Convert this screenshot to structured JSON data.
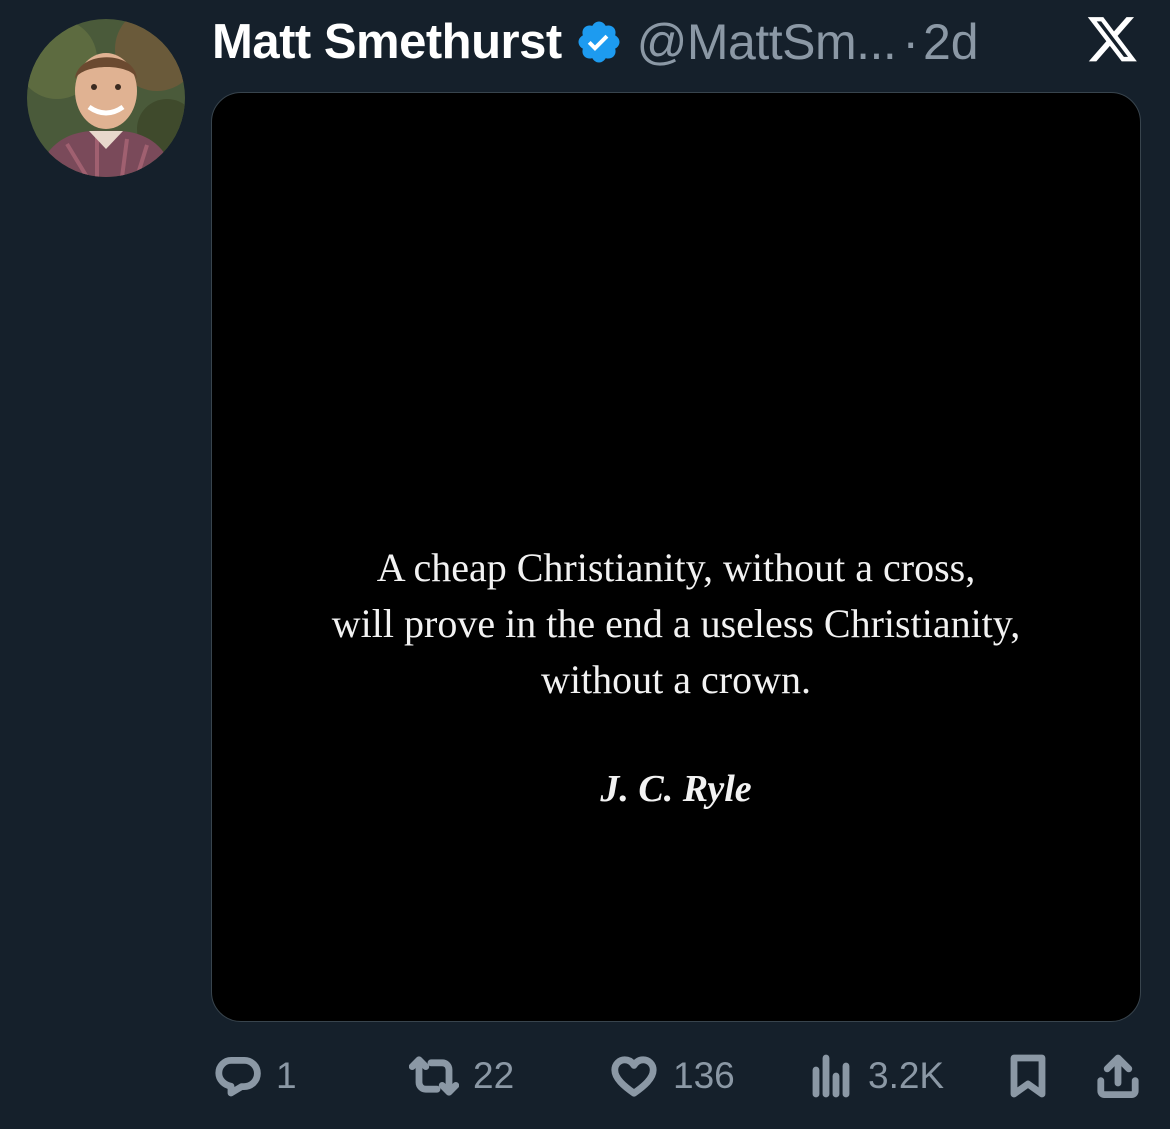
{
  "tweet": {
    "author_name": "Matt Smethurst",
    "handle": "@MattSm...",
    "separator": "·",
    "time": "2d"
  },
  "icons": {
    "verified": "verified-badge-icon",
    "platform": "x-logo-icon"
  },
  "colors": {
    "background": "#15202b",
    "verified_blue": "#1d9bf0",
    "secondary_text": "#8b98a5",
    "media_background": "#000000"
  },
  "media": {
    "quote_lines": [
      "A cheap Christianity, without a cross,",
      "will prove in the end a useless Christianity,",
      "without a crown."
    ],
    "author": "J. C. Ryle"
  },
  "actions": {
    "replies": "1",
    "retweets": "22",
    "likes": "136",
    "views": "3.2K"
  }
}
